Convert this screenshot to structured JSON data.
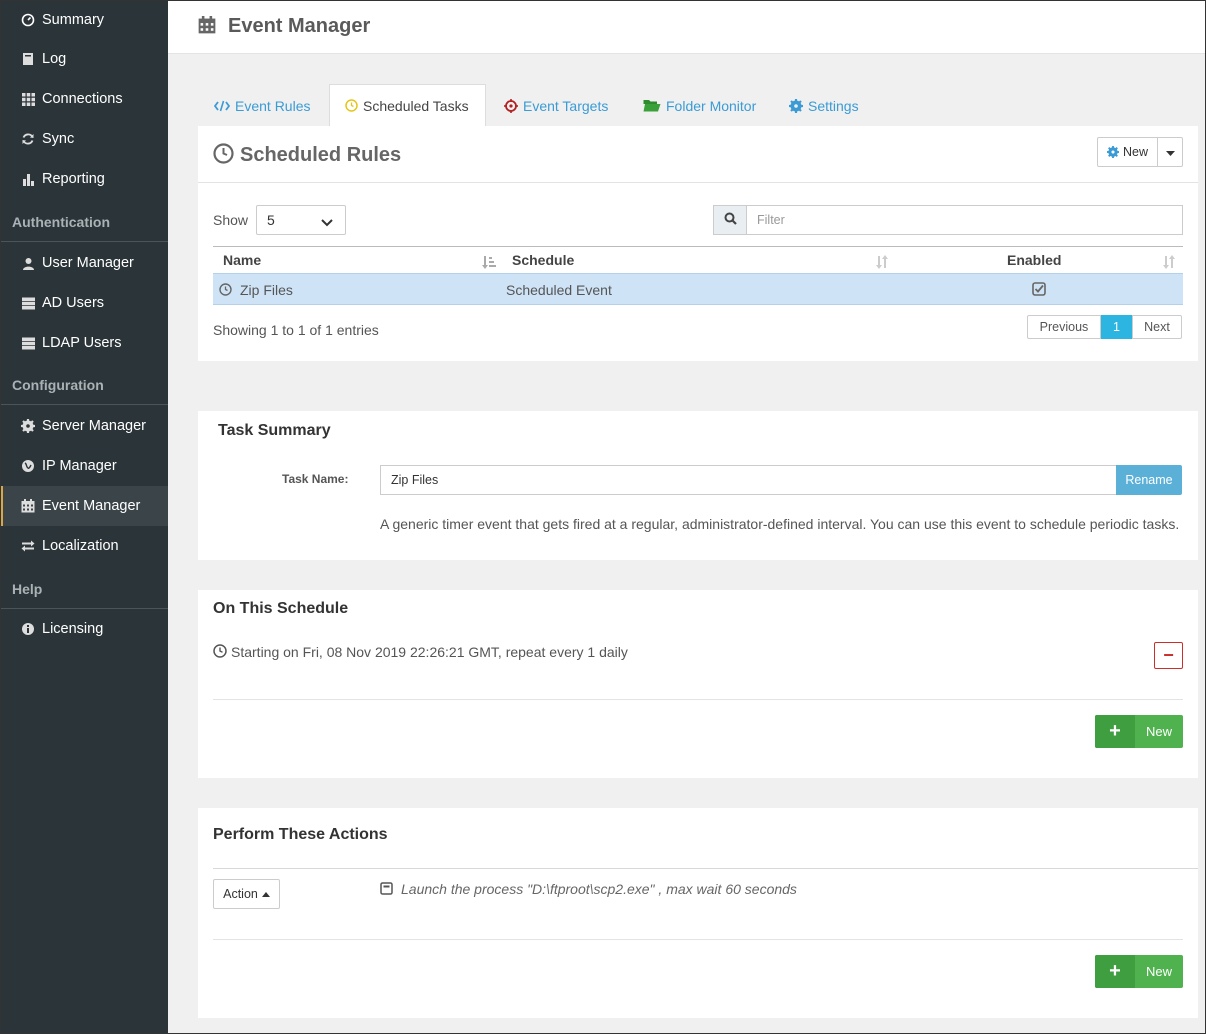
{
  "sidebar": {
    "items_top": [
      {
        "label": "Summary",
        "icon": "dashboard-icon"
      },
      {
        "label": "Log",
        "icon": "book-icon"
      },
      {
        "label": "Connections",
        "icon": "grid-icon"
      },
      {
        "label": "Sync",
        "icon": "refresh-icon"
      },
      {
        "label": "Reporting",
        "icon": "bar-chart-icon"
      }
    ],
    "section_auth": "Authentication",
    "items_auth": [
      {
        "label": "User Manager",
        "icon": "user-icon"
      },
      {
        "label": "AD Users",
        "icon": "server-icon"
      },
      {
        "label": "LDAP Users",
        "icon": "server-icon"
      }
    ],
    "section_config": "Configuration",
    "items_config": [
      {
        "label": "Server Manager",
        "icon": "gear-icon"
      },
      {
        "label": "IP Manager",
        "icon": "globe-icon"
      },
      {
        "label": "Event Manager",
        "icon": "calendar-icon"
      },
      {
        "label": "Localization",
        "icon": "exchange-icon"
      }
    ],
    "section_help": "Help",
    "items_help": [
      {
        "label": "Licensing",
        "icon": "info-icon"
      }
    ],
    "active_item": "Event Manager"
  },
  "header": {
    "title": "Event Manager",
    "icon": "calendar-icon"
  },
  "tabs": [
    {
      "label": "Event Rules",
      "icon": "code-icon"
    },
    {
      "label": "Scheduled Tasks",
      "icon": "clock-icon"
    },
    {
      "label": "Event Targets",
      "icon": "crosshairs-icon"
    },
    {
      "label": "Folder Monitor",
      "icon": "folder-open-icon"
    },
    {
      "label": "Settings",
      "icon": "gear-icon"
    }
  ],
  "active_tab": "Scheduled Tasks",
  "scheduled_rules": {
    "title": "Scheduled Rules",
    "new_label": "New",
    "show_label": "Show",
    "show_value": "5",
    "filter_placeholder": "Filter",
    "columns": [
      "Name",
      "Schedule",
      "Enabled"
    ],
    "rows": [
      {
        "name": "Zip Files",
        "schedule": "Scheduled Event",
        "enabled": true
      }
    ],
    "info": "Showing 1 to 1 of 1 entries",
    "pagination": {
      "previous": "Previous",
      "current": "1",
      "next": "Next"
    }
  },
  "task_summary": {
    "title": "Task Summary",
    "task_name_label": "Task Name:",
    "task_name_value": "Zip Files",
    "rename_label": "Rename",
    "description": "A generic timer event that gets fired at a regular, administrator-defined interval. You can use this event to schedule periodic tasks."
  },
  "schedule": {
    "title": "On This Schedule",
    "entry": "Starting on Fri, 08 Nov 2019 22:26:21 GMT, repeat every 1 daily",
    "remove_label": "−",
    "new_label": "New"
  },
  "actions": {
    "title": "Perform These Actions",
    "action_button_label": "Action",
    "entry": "Launch the process \"D:\\ftproot\\scp2.exe\" , max wait 60 seconds",
    "new_label": "New"
  },
  "colors": {
    "sidebar_bg": "#2b3438",
    "active_accent": "#d9a64a",
    "link": "#3a9bd5",
    "selected_row": "#cfe3f7",
    "pagination_active": "#2bb5e0",
    "rename_btn": "#5bb0d8",
    "green": "#4fb24f",
    "danger": "#c9302c"
  }
}
